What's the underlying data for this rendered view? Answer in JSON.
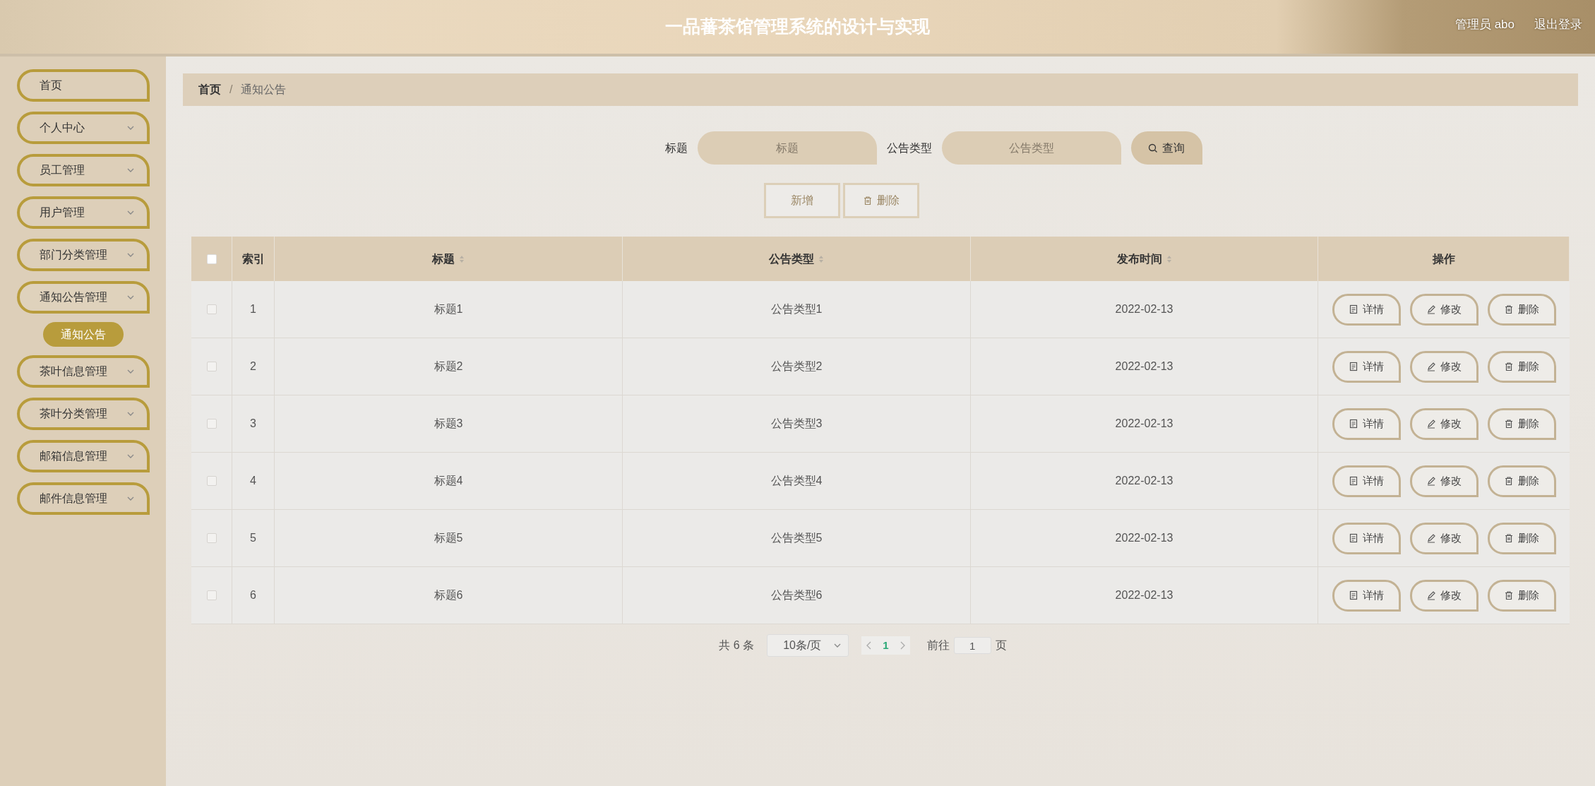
{
  "header": {
    "title": "一品蕃茶馆管理系统的设计与实现",
    "user": "管理员 abo",
    "logout": "退出登录"
  },
  "sidebar": {
    "items": [
      {
        "label": "首页",
        "expandable": false
      },
      {
        "label": "个人中心",
        "expandable": true,
        "expanded": false
      },
      {
        "label": "员工管理",
        "expandable": true,
        "expanded": false
      },
      {
        "label": "用户管理",
        "expandable": true,
        "expanded": false
      },
      {
        "label": "部门分类管理",
        "expandable": true,
        "expanded": false
      },
      {
        "label": "通知公告管理",
        "expandable": true,
        "expanded": true,
        "children": [
          {
            "label": "通知公告",
            "selected": true
          }
        ]
      },
      {
        "label": "茶叶信息管理",
        "expandable": true,
        "expanded": false
      },
      {
        "label": "茶叶分类管理",
        "expandable": true,
        "expanded": false
      },
      {
        "label": "邮箱信息管理",
        "expandable": true,
        "expanded": false
      },
      {
        "label": "邮件信息管理",
        "expandable": true,
        "expanded": false
      }
    ]
  },
  "breadcrumb": {
    "items": [
      "首页",
      "通知公告"
    ],
    "separator": "/"
  },
  "search": {
    "fields": [
      {
        "label": "标题",
        "placeholder": "标题"
      },
      {
        "label": "公告类型",
        "placeholder": "公告类型"
      }
    ],
    "button": "查询"
  },
  "toolbar": [
    {
      "label": "新增",
      "kind": "add"
    },
    {
      "label": "删除",
      "kind": "delete"
    }
  ],
  "table": {
    "all_checked": false,
    "columns": [
      {
        "label": "索引",
        "sortable": false
      },
      {
        "label": "标题",
        "sortable": true
      },
      {
        "label": "公告类型",
        "sortable": true
      },
      {
        "label": "发布时间",
        "sortable": true
      },
      {
        "label": "操作",
        "sortable": false
      }
    ],
    "rows": [
      {
        "checked": false,
        "cells": [
          "1",
          "标题1",
          "公告类型1",
          "2022-02-13"
        ],
        "actions": [
          {
            "label": "详情",
            "kind": "detail"
          },
          {
            "label": "修改",
            "kind": "edit"
          },
          {
            "label": "删除",
            "kind": "delete"
          }
        ]
      },
      {
        "checked": false,
        "cells": [
          "2",
          "标题2",
          "公告类型2",
          "2022-02-13"
        ],
        "actions": [
          {
            "label": "详情",
            "kind": "detail"
          },
          {
            "label": "修改",
            "kind": "edit"
          },
          {
            "label": "删除",
            "kind": "delete"
          }
        ]
      },
      {
        "checked": false,
        "cells": [
          "3",
          "标题3",
          "公告类型3",
          "2022-02-13"
        ],
        "actions": [
          {
            "label": "详情",
            "kind": "detail"
          },
          {
            "label": "修改",
            "kind": "edit"
          },
          {
            "label": "删除",
            "kind": "delete"
          }
        ]
      },
      {
        "checked": false,
        "cells": [
          "4",
          "标题4",
          "公告类型4",
          "2022-02-13"
        ],
        "actions": [
          {
            "label": "详情",
            "kind": "detail"
          },
          {
            "label": "修改",
            "kind": "edit"
          },
          {
            "label": "删除",
            "kind": "delete"
          }
        ]
      },
      {
        "checked": false,
        "cells": [
          "5",
          "标题5",
          "公告类型5",
          "2022-02-13"
        ],
        "actions": [
          {
            "label": "详情",
            "kind": "detail"
          },
          {
            "label": "修改",
            "kind": "edit"
          },
          {
            "label": "删除",
            "kind": "delete"
          }
        ]
      },
      {
        "checked": false,
        "cells": [
          "6",
          "标题6",
          "公告类型6",
          "2022-02-13"
        ],
        "actions": [
          {
            "label": "详情",
            "kind": "detail"
          },
          {
            "label": "修改",
            "kind": "edit"
          },
          {
            "label": "删除",
            "kind": "delete"
          }
        ]
      }
    ]
  },
  "pagination": {
    "total": "共 6 条",
    "page_size": "10条/页",
    "pages": [
      {
        "label": "1",
        "selected": true
      }
    ],
    "goto_label": "前往",
    "goto_value": "1",
    "goto_suffix": "页"
  }
}
